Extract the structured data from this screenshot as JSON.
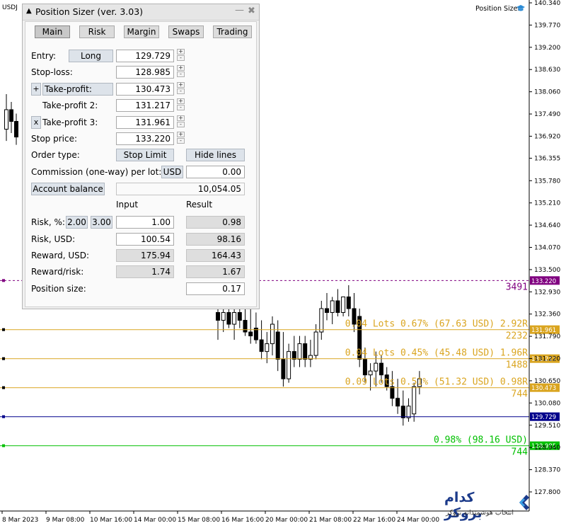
{
  "chart": {
    "symbol_label": "USDJ",
    "indicator_label": "Position Sizer",
    "y_axis": {
      "min": 127.8,
      "max": 140.34,
      "ticks": [
        "140.340",
        "139.770",
        "139.200",
        "138.630",
        "138.060",
        "137.490",
        "136.920",
        "136.355",
        "135.780",
        "135.210",
        "134.640",
        "134.070",
        "133.500",
        "132.930",
        "132.360",
        "131.790",
        "131.220",
        "130.650",
        "130.080",
        "129.510",
        "128.940",
        "128.370",
        "127.800"
      ]
    },
    "x_axis": {
      "labels": [
        "8 Mar 2023",
        "9 Mar 08:00",
        "10 Mar 16:00",
        "14 Mar 00:00",
        "15 Mar 08:00",
        "16 Mar 16:00",
        "20 Mar 00:00",
        "21 Mar 08:00",
        "22 Mar 16:00",
        "24 Mar 00:00"
      ]
    },
    "levels": [
      {
        "name": "stop-price",
        "price": 133.22,
        "tag": "133.220",
        "color": "#800080",
        "style": "dotted",
        "labels": [
          "3491"
        ]
      },
      {
        "name": "take-profit-3",
        "price": 131.961,
        "tag": "131.961",
        "color": "#daa520",
        "style": "solid",
        "labels": [
          "0.04 Lots 0.67% (67.63 USD) 2.92R",
          "2232"
        ]
      },
      {
        "name": "take-profit-2",
        "price": 131.217,
        "tag": "131.217",
        "color": "#daa520",
        "style": "solid",
        "labels": [
          "0.04 Lots 0.45% (45.48 USD) 1.96R",
          "1488"
        ]
      },
      {
        "name": "take-profit",
        "price": 130.473,
        "tag": "130.473",
        "color": "#daa520",
        "style": "solid",
        "labels": [
          "0.09 Lots 0.51% (51.32 USD) 0.98R",
          "744"
        ]
      },
      {
        "name": "entry",
        "price": 129.729,
        "tag": "129.729",
        "color": "#00008b",
        "style": "solid",
        "labels": []
      },
      {
        "name": "stop-loss",
        "price": 128.985,
        "tag": "128.985",
        "color": "#00c000",
        "style": "solid",
        "labels": [
          "0.98% (98.16 USD)",
          "744"
        ]
      }
    ],
    "candles": [
      {
        "o": 137.1,
        "h": 138.0,
        "l": 136.8,
        "c": 137.6
      },
      {
        "o": 137.6,
        "h": 137.8,
        "l": 137.0,
        "c": 137.3
      },
      {
        "o": 137.3,
        "h": 137.5,
        "l": 136.7,
        "c": 136.9
      },
      {
        "o": 132.4,
        "h": 132.7,
        "l": 131.7,
        "c": 132.2
      },
      {
        "o": 132.2,
        "h": 132.6,
        "l": 131.9,
        "c": 132.4
      },
      {
        "o": 132.4,
        "h": 132.6,
        "l": 132.0,
        "c": 132.1
      },
      {
        "o": 132.1,
        "h": 132.6,
        "l": 131.7,
        "c": 132.4
      },
      {
        "o": 132.4,
        "h": 132.7,
        "l": 132.0,
        "c": 132.2
      },
      {
        "o": 132.2,
        "h": 132.5,
        "l": 131.8,
        "c": 131.9
      },
      {
        "o": 131.9,
        "h": 132.7,
        "l": 131.6,
        "c": 131.8
      },
      {
        "o": 132.0,
        "h": 132.4,
        "l": 131.6,
        "c": 131.7
      },
      {
        "o": 131.7,
        "h": 132.2,
        "l": 131.2,
        "c": 131.4
      },
      {
        "o": 131.4,
        "h": 131.9,
        "l": 131.1,
        "c": 131.6
      },
      {
        "o": 131.6,
        "h": 132.3,
        "l": 131.3,
        "c": 132.1
      },
      {
        "o": 131.9,
        "h": 132.2,
        "l": 130.9,
        "c": 131.2
      },
      {
        "o": 131.2,
        "h": 131.9,
        "l": 130.5,
        "c": 130.7
      },
      {
        "o": 130.7,
        "h": 131.6,
        "l": 130.6,
        "c": 131.4
      },
      {
        "o": 131.4,
        "h": 131.8,
        "l": 131.0,
        "c": 131.2
      },
      {
        "o": 131.2,
        "h": 131.8,
        "l": 131.0,
        "c": 131.6
      },
      {
        "o": 131.6,
        "h": 131.8,
        "l": 131.0,
        "c": 131.2
      },
      {
        "o": 131.2,
        "h": 131.7,
        "l": 131.0,
        "c": 131.3
      },
      {
        "o": 131.3,
        "h": 132.1,
        "l": 131.2,
        "c": 131.9
      },
      {
        "o": 131.9,
        "h": 132.7,
        "l": 131.7,
        "c": 132.5
      },
      {
        "o": 132.5,
        "h": 132.9,
        "l": 132.2,
        "c": 132.4
      },
      {
        "o": 132.4,
        "h": 132.8,
        "l": 132.1,
        "c": 132.7
      },
      {
        "o": 132.7,
        "h": 133.0,
        "l": 132.3,
        "c": 132.4
      },
      {
        "o": 132.4,
        "h": 132.8,
        "l": 132.3,
        "c": 132.8
      },
      {
        "o": 132.8,
        "h": 133.1,
        "l": 132.3,
        "c": 132.5
      },
      {
        "o": 132.5,
        "h": 132.9,
        "l": 131.9,
        "c": 132.1
      },
      {
        "o": 132.3,
        "h": 132.5,
        "l": 131.0,
        "c": 131.2
      },
      {
        "o": 131.2,
        "h": 131.5,
        "l": 130.6,
        "c": 130.8
      },
      {
        "o": 130.8,
        "h": 131.1,
        "l": 130.4,
        "c": 130.9
      },
      {
        "o": 130.9,
        "h": 131.4,
        "l": 130.5,
        "c": 131.1
      },
      {
        "o": 131.1,
        "h": 131.3,
        "l": 130.6,
        "c": 130.8
      },
      {
        "o": 130.8,
        "h": 131.0,
        "l": 130.4,
        "c": 130.5
      },
      {
        "o": 130.5,
        "h": 130.9,
        "l": 130.0,
        "c": 130.2
      },
      {
        "o": 130.2,
        "h": 130.7,
        "l": 129.8,
        "c": 130.0
      },
      {
        "o": 130.0,
        "h": 130.4,
        "l": 129.5,
        "c": 129.7
      },
      {
        "o": 129.7,
        "h": 130.2,
        "l": 129.6,
        "c": 130.0
      },
      {
        "o": 129.8,
        "h": 130.6,
        "l": 129.6,
        "c": 130.5
      },
      {
        "o": 130.5,
        "h": 130.9,
        "l": 130.3,
        "c": 130.7
      }
    ]
  },
  "panel": {
    "title": "Position Sizer (ver. 3.03)",
    "tabs": [
      "Main",
      "Risk",
      "Margin",
      "Swaps",
      "Trading"
    ],
    "entry_label": "Entry:",
    "direction_button": "Long",
    "entry_value": "129.729",
    "stoploss_label": "Stop-loss:",
    "stoploss_value": "128.985",
    "tp_plus": "+",
    "tp_label": "Take-profit:",
    "tp_value": "130.473",
    "tp2_label": "Take-profit 2:",
    "tp2_value": "131.217",
    "tp3_remove": "x",
    "tp3_label": "Take-profit 3:",
    "tp3_value": "131.961",
    "stopprice_label": "Stop price:",
    "stopprice_value": "133.220",
    "ordertype_label": "Order type:",
    "ordertype_button": "Stop Limit",
    "hidelines_button": "Hide lines",
    "commission_label": "Commission (one-way) per lot:",
    "commission_currency": "USD",
    "commission_value": "0.00",
    "account_button": "Account balance",
    "account_value": "10,054.05",
    "col_input": "Input",
    "col_result": "Result",
    "risk_pct_label": "Risk, %:",
    "risk_preset_1": "2.00",
    "risk_preset_2": "3.00",
    "risk_pct_input": "1.00",
    "risk_pct_result": "0.98",
    "risk_usd_label": "Risk, USD:",
    "risk_usd_input": "100.54",
    "risk_usd_result": "98.16",
    "reward_usd_label": "Reward, USD:",
    "reward_usd_input": "175.94",
    "reward_usd_result": "164.43",
    "rr_label": "Reward/risk:",
    "rr_input": "1.74",
    "rr_result": "1.67",
    "possize_label": "Position size:",
    "possize_value": "0.17",
    "spin_up": "+",
    "spin_down": "-",
    "minimize": "—",
    "close": "✖"
  },
  "logo": {
    "main": "کدام بروکر",
    "sub": "انتخاب هوشمندانه بروکر",
    "brand_color": "#1b3a8a"
  }
}
